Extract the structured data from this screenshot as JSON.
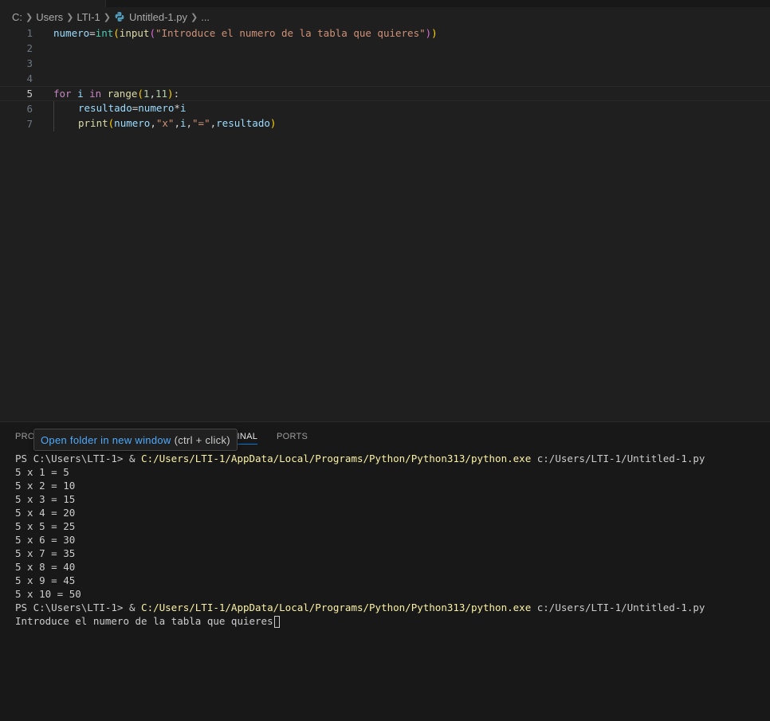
{
  "colors": {
    "editor_bg": "#1f1f1f",
    "panel_bg": "#181818",
    "link": "#4daafc",
    "accent": "#0078d4",
    "ps_path": "#f9f1a5"
  },
  "breadcrumb": {
    "drive": "C:",
    "users": "Users",
    "user": "LTI-1",
    "file": "Untitled-1.py",
    "more": "...",
    "separator_icon": "chevron-right-icon",
    "file_icon": "python-icon"
  },
  "editor": {
    "lines": [
      {
        "n": "1"
      },
      {
        "n": "2"
      },
      {
        "n": "3"
      },
      {
        "n": "4"
      },
      {
        "n": "5"
      },
      {
        "n": "6"
      },
      {
        "n": "7"
      }
    ],
    "code": {
      "l1_var": "numero",
      "l1_eq": "=",
      "l1_int": "int",
      "l1_p1": "(",
      "l1_input": "input",
      "l1_p2": "(",
      "l1_str": "\"Introduce el numero de la tabla que quieres\"",
      "l1_p3": ")",
      "l1_p4": ")",
      "l5_for": "for",
      "l5_i": " i ",
      "l5_in": "in",
      "l5_sp": " ",
      "l5_range": "range",
      "l5_p1": "(",
      "l5_a": "1",
      "l5_comma": ",",
      "l5_b": "11",
      "l5_p2": ")",
      "l5_colon": ":",
      "l6_res": "resultado",
      "l6_eq": "=",
      "l6_num": "numero",
      "l6_mul": "*",
      "l6_i": "i",
      "l7_print": "print",
      "l7_p1": "(",
      "l7_num": "numero",
      "l7_c1": ",",
      "l7_x": "\"x\"",
      "l7_c2": ",",
      "l7_i": "i",
      "l7_c3": ",",
      "l7_eqs": "\"=\"",
      "l7_c4": ",",
      "l7_res": "resultado",
      "l7_p2": ")"
    }
  },
  "panel": {
    "tab_problems": "PROI",
    "tab_terminal": "MINAL",
    "tab_ports": "PORTS",
    "tooltip_link": "Open folder in new window",
    "tooltip_hint": "(ctrl + click)"
  },
  "terminal": {
    "prompt": "PS C:\\Users\\LTI-1> & ",
    "exe_path": "C:/Users/LTI-1/AppData/Local/Programs/Python/Python313/python.exe",
    "script_arg": " c:/Users/LTI-1/Untitled-1.py",
    "output": [
      "5 x 1 = 5",
      "5 x 2 = 10",
      "5 x 3 = 15",
      "5 x 4 = 20",
      "5 x 5 = 25",
      "5 x 6 = 30",
      "5 x 7 = 35",
      "5 x 8 = 40",
      "5 x 9 = 45",
      "5 x 10 = 50"
    ],
    "input_prompt": "Introduce el numero de la tabla que quieres"
  }
}
